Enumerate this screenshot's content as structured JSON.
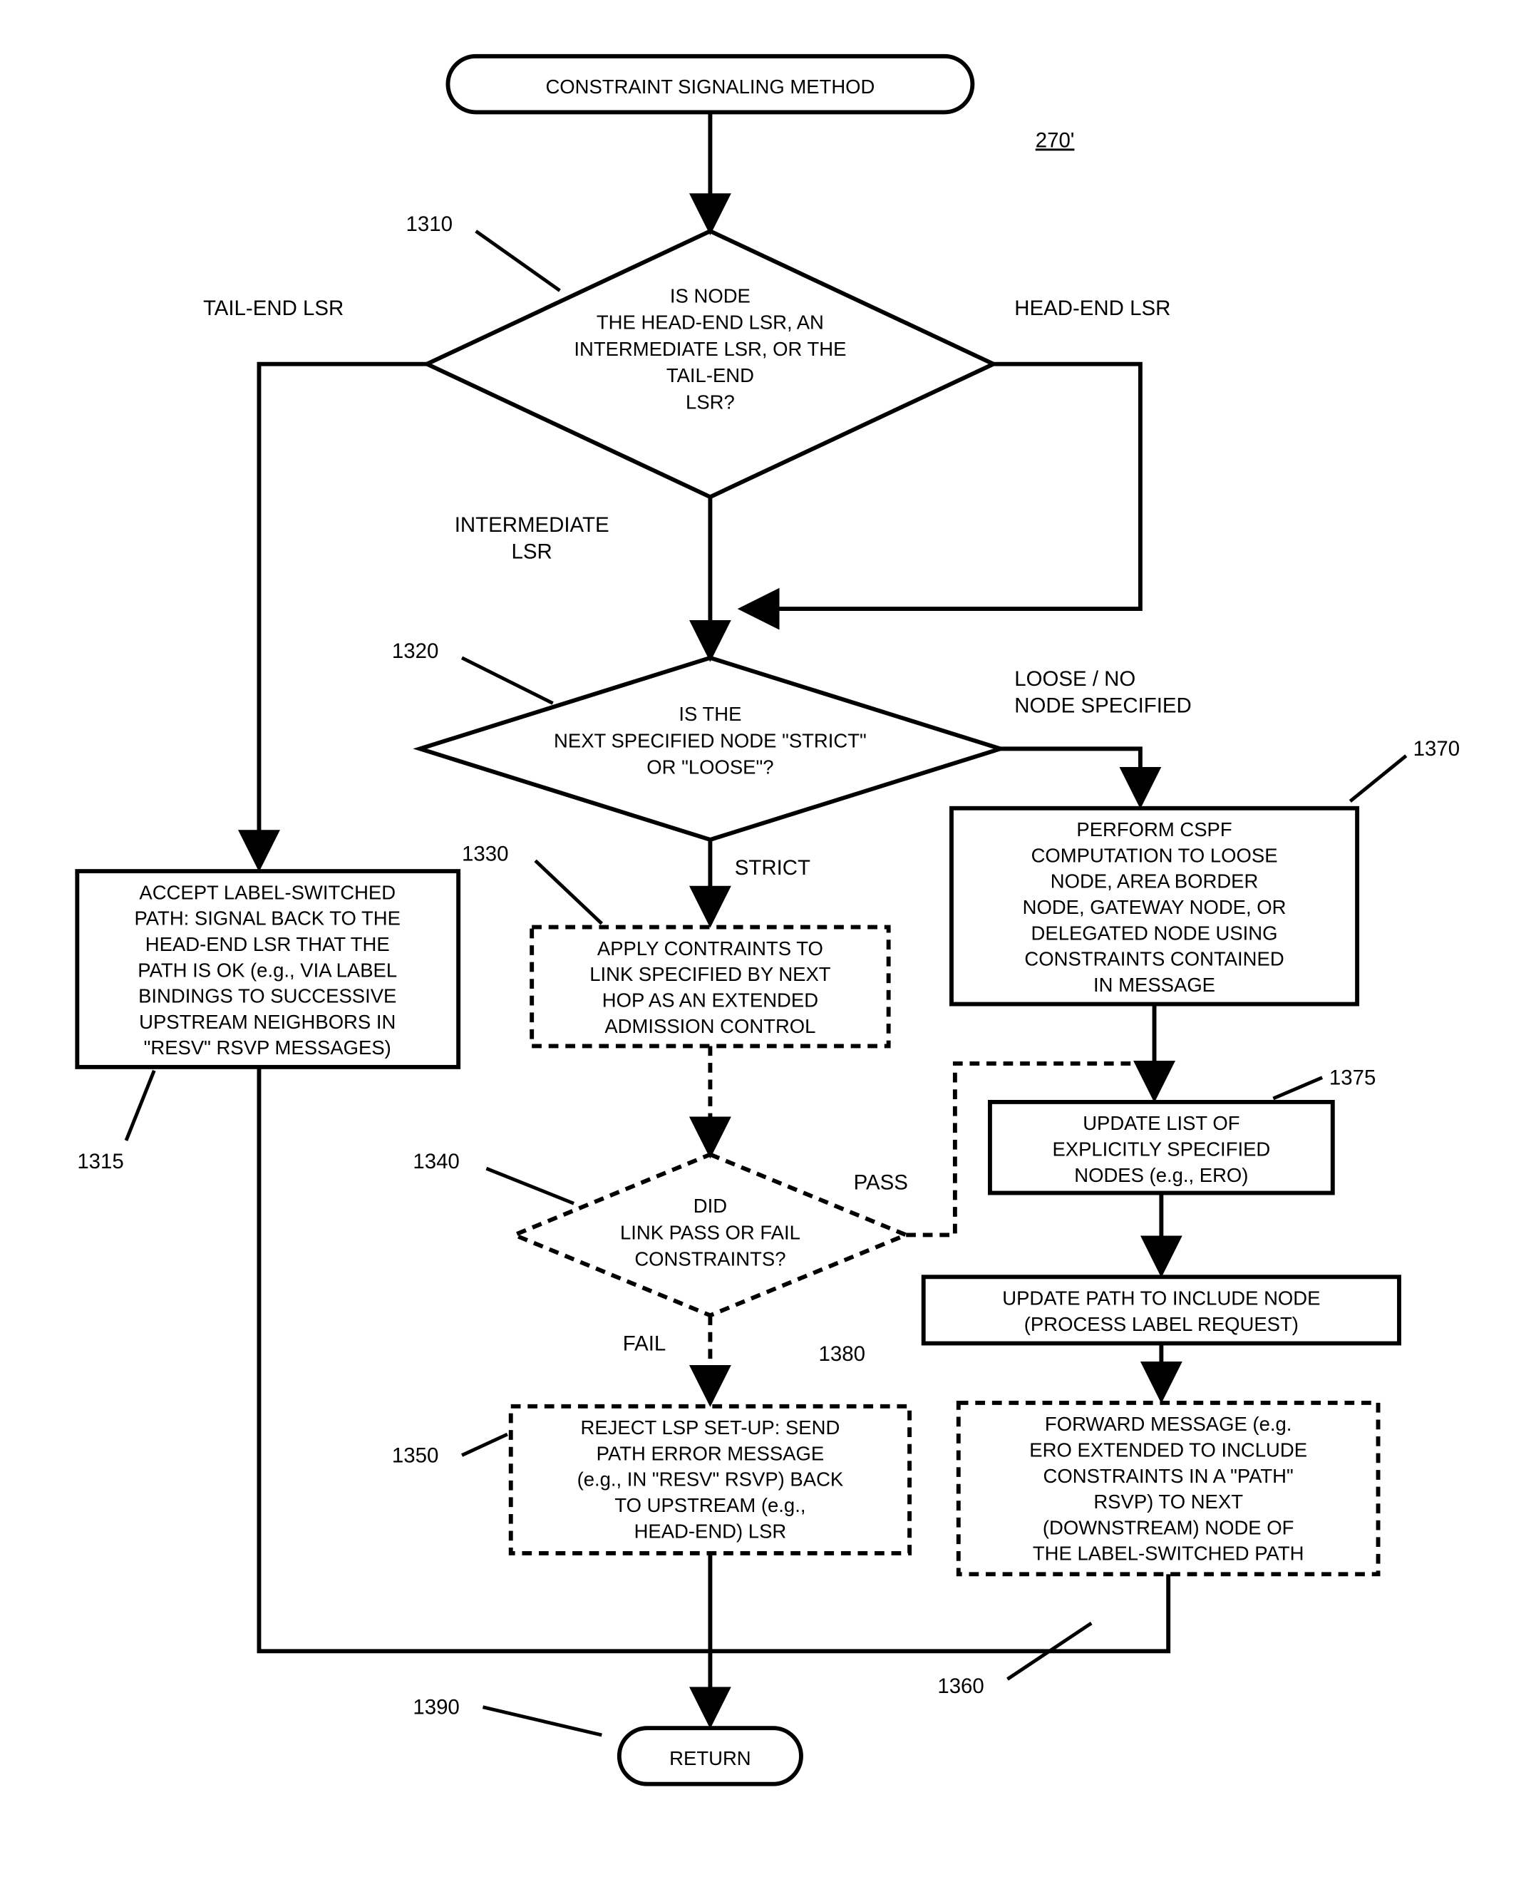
{
  "ref": "270'",
  "terminals": {
    "start": "CONSTRAINT SIGNALING METHOD",
    "end": "RETURN"
  },
  "decisions": {
    "d1310": [
      "IS NODE",
      "THE HEAD-END LSR, AN",
      "INTERMEDIATE LSR, OR THE",
      "TAIL-END",
      "LSR?"
    ],
    "d1320": [
      "IS THE",
      "NEXT SPECIFIED NODE \"STRICT\"",
      "OR \"LOOSE\"?"
    ],
    "d1340": [
      "DID",
      "LINK PASS OR FAIL",
      "CONSTRAINTS?"
    ]
  },
  "processes": {
    "p1315": [
      "ACCEPT LABEL-SWITCHED",
      "PATH:  SIGNAL BACK TO THE",
      "HEAD-END LSR THAT THE",
      "PATH IS OK (e.g., VIA LABEL",
      "BINDINGS TO SUCCESSIVE",
      "UPSTREAM NEIGHBORS IN",
      "\"RESV\" RSVP MESSAGES)"
    ],
    "p1330": [
      "APPLY CONTRAINTS TO",
      "LINK SPECIFIED BY NEXT",
      "HOP AS AN EXTENDED",
      "ADMISSION CONTROL"
    ],
    "p1350": [
      "REJECT LSP SET-UP:  SEND",
      "PATH ERROR MESSAGE",
      "(e.g., IN \"RESV\" RSVP) BACK",
      "TO UPSTREAM (e.g.,",
      "HEAD-END) LSR"
    ],
    "p1370": [
      "PERFORM CSPF",
      "COMPUTATION TO LOOSE",
      "NODE, AREA BORDER",
      "NODE, GATEWAY NODE, OR",
      "DELEGATED NODE USING",
      "CONSTRAINTS CONTAINED",
      "IN MESSAGE"
    ],
    "p1375": [
      "UPDATE LIST OF",
      "EXPLICITLY SPECIFIED",
      "NODES (e.g., ERO)"
    ],
    "p1380": [
      "UPDATE PATH TO INCLUDE NODE",
      "(PROCESS LABEL REQUEST)"
    ],
    "p1360": [
      "FORWARD MESSAGE (e.g.",
      "ERO EXTENDED TO INCLUDE",
      "CONSTRAINTS IN A \"PATH\"",
      "RSVP) TO NEXT",
      "(DOWNSTREAM) NODE OF",
      "THE LABEL-SWITCHED PATH"
    ]
  },
  "branch_labels": {
    "tail": "TAIL-END LSR",
    "head": "HEAD-END LSR",
    "intermediate": [
      "INTERMEDIATE",
      "LSR"
    ],
    "loose": [
      "LOOSE / NO",
      "NODE SPECIFIED"
    ],
    "strict": "STRICT",
    "pass": "PASS",
    "fail": "FAIL"
  },
  "callouts": {
    "c1310": "1310",
    "c1315": "1315",
    "c1320": "1320",
    "c1330": "1330",
    "c1340": "1340",
    "c1350": "1350",
    "c1360": "1360",
    "c1370": "1370",
    "c1375": "1375",
    "c1380": "1380",
    "c1390": "1390"
  }
}
